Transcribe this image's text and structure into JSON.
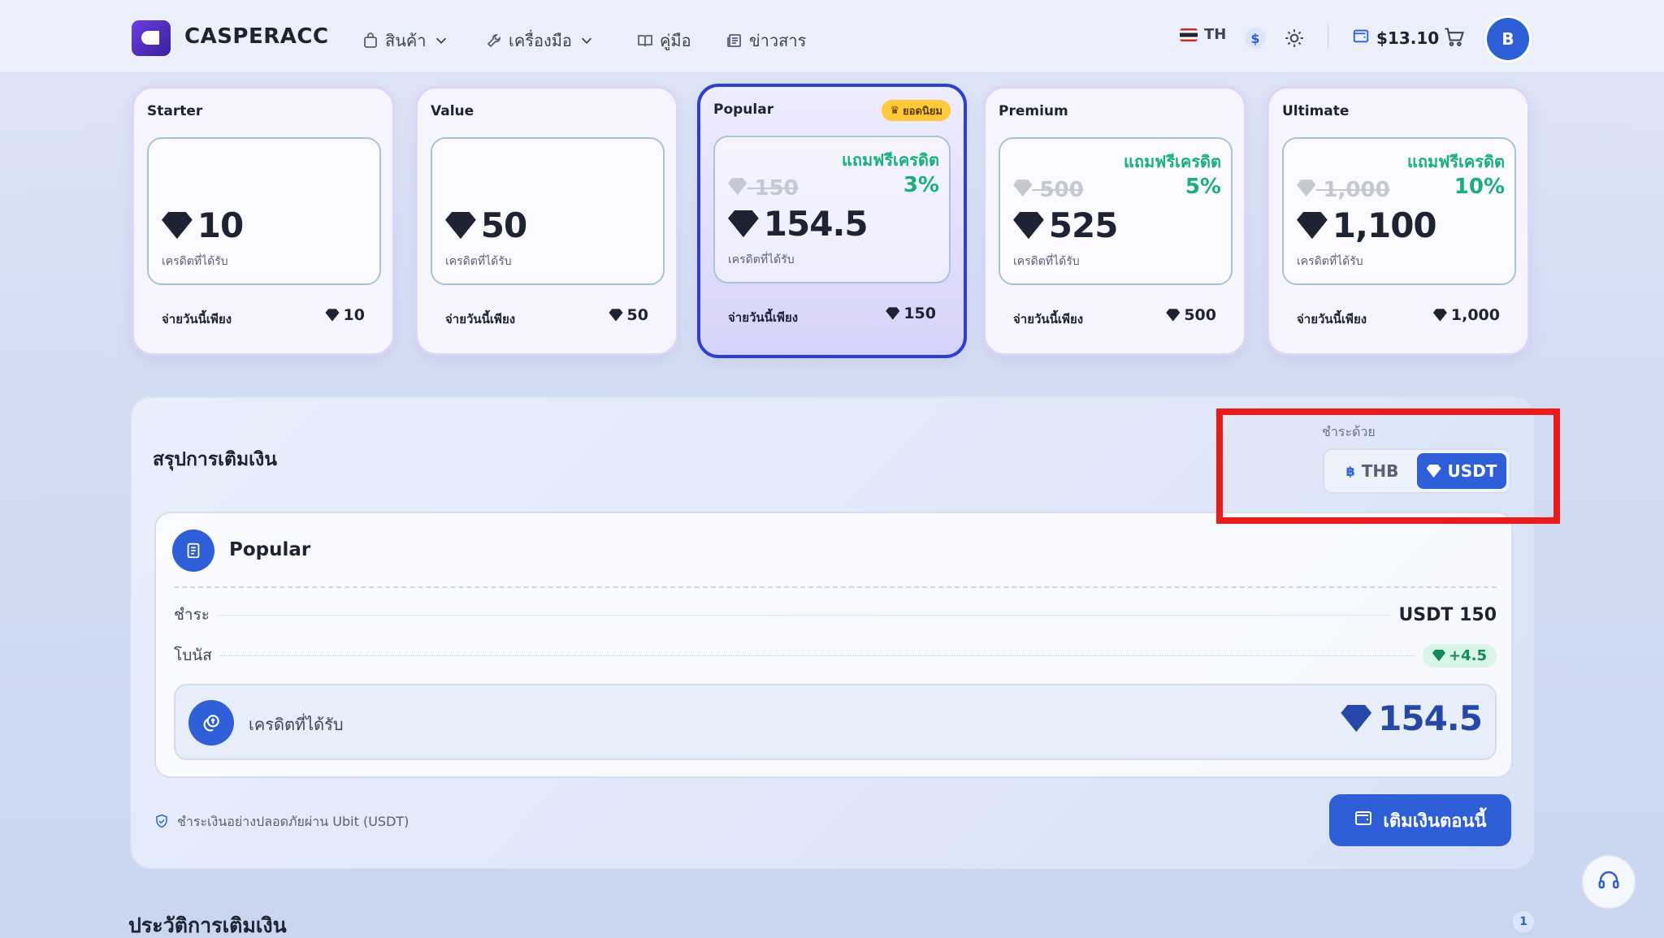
{
  "header": {
    "brand": "CASPERACC",
    "nav": [
      {
        "label": "สินค้า",
        "icon": "bag-icon",
        "dropdown": true
      },
      {
        "label": "เครื่องมือ",
        "icon": "wrench-icon",
        "dropdown": true
      },
      {
        "label": "คู่มือ",
        "icon": "book-icon",
        "dropdown": false
      },
      {
        "label": "ข่าวสาร",
        "icon": "newspaper-icon",
        "dropdown": false
      }
    ],
    "language": "TH",
    "currency_symbol": "$",
    "balance": "$13.10",
    "avatar_letter": "B"
  },
  "packages": [
    {
      "name": "Starter",
      "credits": "10",
      "label": "เครดิตที่ได้รับ",
      "pay_label": "จ่ายวันนี้เพียง",
      "pay": "10",
      "selected": false
    },
    {
      "name": "Value",
      "credits": "50",
      "label": "เครดิตที่ได้รับ",
      "pay_label": "จ่ายวันนี้เพียง",
      "pay": "50",
      "selected": false
    },
    {
      "name": "Popular",
      "badge": "ยอดนิยม",
      "free_label": "แถมฟรีเครดิต",
      "bonus_pct": "3%",
      "old": "150",
      "credits": "154.5",
      "label": "เครดิตที่ได้รับ",
      "pay_label": "จ่ายวันนี้เพียง",
      "pay": "150",
      "selected": true
    },
    {
      "name": "Premium",
      "free_label": "แถมฟรีเครดิต",
      "bonus_pct": "5%",
      "old": "500",
      "credits": "525",
      "label": "เครดิตที่ได้รับ",
      "pay_label": "จ่ายวันนี้เพียง",
      "pay": "500",
      "selected": false
    },
    {
      "name": "Ultimate",
      "free_label": "แถมฟรีเครดิต",
      "bonus_pct": "10%",
      "old": "1,000",
      "credits": "1,100",
      "label": "เครดิตที่ได้รับ",
      "pay_label": "จ่ายวันนี้เพียง",
      "pay": "1,000",
      "selected": false
    }
  ],
  "summary": {
    "title": "สรุปการเติมเงิน",
    "pay_with_label": "ชำระด้วย",
    "options": [
      {
        "label": "THB",
        "symbol": "฿",
        "active": false
      },
      {
        "label": "USDT",
        "active": true
      }
    ],
    "package_name": "Popular",
    "pay_label": "ชำระ",
    "pay_value": "USDT 150",
    "bonus_label": "โบนัส",
    "bonus_value": "+4.5",
    "credit_label": "เครดิตที่ได้รับ",
    "credit_value": "154.5",
    "secure_note": "ชำระเงินอย่างปลอดภัยผ่าน Ubit (USDT)",
    "topup_label": "เติมเงินตอนนี้"
  },
  "history": {
    "title": "ประวัติการเติมเงิน",
    "count": "1"
  },
  "colors": {
    "accent": "#2f5fd8",
    "selected_border": "#2d3fd1",
    "bonus_green": "#18b07a",
    "badge": "#ffc93a",
    "highlight": "#ee1a1a"
  }
}
